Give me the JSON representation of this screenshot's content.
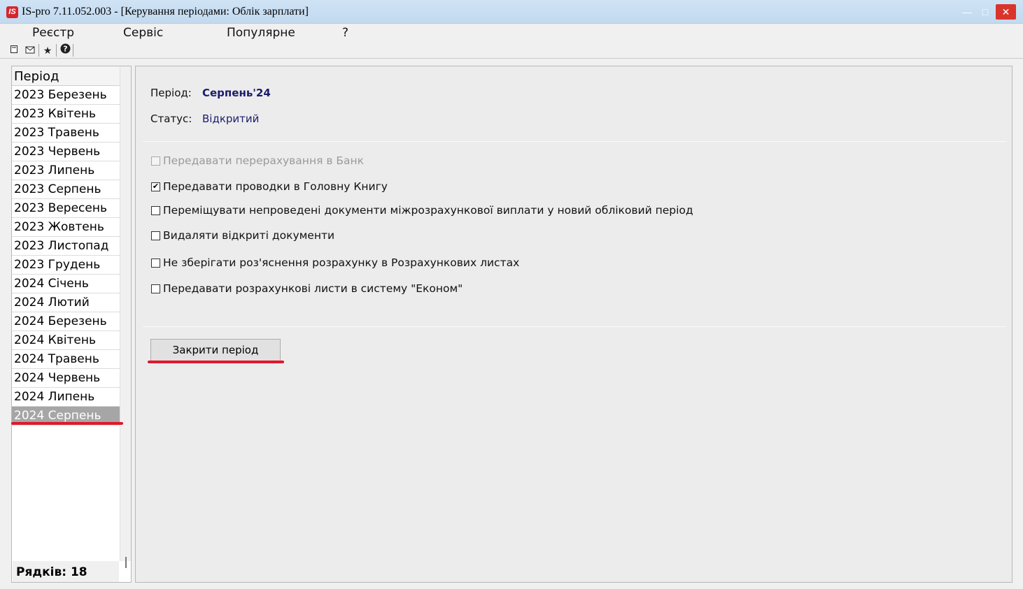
{
  "window": {
    "app_icon": "IS",
    "title": "IS-pro 7.11.052.003 - [Керування періодами: Облік зарплати]",
    "minimize_icon": "minimize-icon",
    "maximize_icon": "maximize-icon",
    "close_icon": "close-icon"
  },
  "menu": {
    "items": [
      "Реєстр",
      "Сервіс",
      "Популярне",
      "?"
    ]
  },
  "toolbar": {
    "icons": [
      "document-icon",
      "mail-icon",
      "star-icon",
      "help-icon"
    ]
  },
  "left_panel": {
    "header": "Період",
    "periods": [
      "2023 Березень",
      "2023 Квітень",
      "2023 Травень",
      "2023 Червень",
      "2023 Липень",
      "2023 Серпень",
      "2023 Вересень",
      "2023 Жовтень",
      "2023 Листопад",
      "2023 Грудень",
      "2024 Січень",
      "2024 Лютий",
      "2024 Березень",
      "2024 Квітень",
      "2024 Травень",
      "2024 Червень",
      "2024 Липень",
      "2024 Серпень"
    ],
    "selected": "2024 Серпень",
    "rows_count": "Рядків: 18"
  },
  "main": {
    "period_label": "Період:",
    "period_value": "Серпень'24",
    "status_label": "Статус:",
    "status_value": "Відкритий",
    "options": [
      {
        "label": "Передавати перерахування в Банк",
        "checked": false,
        "disabled": true
      },
      {
        "label": "Передавати проводки в Головну Книгу",
        "checked": true,
        "disabled": false
      },
      {
        "label": "Переміщувати непроведені документи міжрозрахункової виплати у новий обліковий період",
        "checked": false,
        "disabled": false
      },
      {
        "label": "Видаляти відкриті документи",
        "checked": false,
        "disabled": false
      },
      {
        "label": "Не зберігати роз'яснення розрахунку в Розрахункових листах",
        "checked": false,
        "disabled": false
      },
      {
        "label": "Передавати розрахункові листи в систему \"Економ\"",
        "checked": false,
        "disabled": false
      }
    ],
    "close_button": "Закрити період"
  },
  "colors": {
    "accent_value": "#1c1c6e",
    "highlight_underline": "#e0182a",
    "selected_row": "#a6a6a6"
  }
}
